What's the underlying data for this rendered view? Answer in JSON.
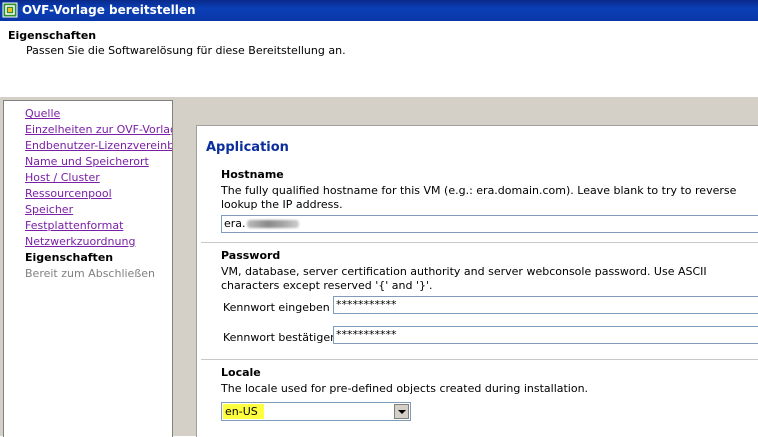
{
  "window": {
    "title": "OVF-Vorlage bereitstellen"
  },
  "header": {
    "title": "Eigenschaften",
    "subtitle": "Passen Sie die Softwarelösung für diese Bereitstellung an."
  },
  "nav": {
    "items": [
      {
        "label": "Quelle"
      },
      {
        "label": "Einzelheiten zur OVF-Vorlage"
      },
      {
        "label": "Endbenutzer-Lizenzvereinbaru"
      },
      {
        "label": "Name und Speicherort"
      },
      {
        "label": "Host / Cluster"
      },
      {
        "label": "Ressourcenpool"
      },
      {
        "label": "Speicher"
      },
      {
        "label": "Festplattenformat"
      },
      {
        "label": "Netzwerkzuordnung"
      },
      {
        "label": "Eigenschaften"
      },
      {
        "label": "Bereit zum Abschließen"
      }
    ]
  },
  "app": {
    "title": "Application",
    "hostname": {
      "title": "Hostname",
      "description": "The fully qualified hostname for this VM (e.g.: era.domain.com). Leave blank to try to reverse lookup the IP address.",
      "value_visible": "era."
    },
    "password": {
      "title": "Password",
      "description": "VM, database, server certification authority and server webconsole password. Use ASCII characters except reserved '{' and '}'.",
      "enter_label": "Kennwort eingeben",
      "enter_value": "***********",
      "confirm_label": "Kennwort bestätigen",
      "confirm_value": "***********"
    },
    "locale": {
      "title": "Locale",
      "description": "The locale used for pre-defined objects created during installation.",
      "selected": "en-US"
    }
  },
  "colors": {
    "titlebar": "#0b3fb6",
    "link": "#7a1fa6",
    "app_title": "#0a2f9c",
    "highlight": "#ffff40",
    "panel_bg": "#d4d0c8"
  }
}
